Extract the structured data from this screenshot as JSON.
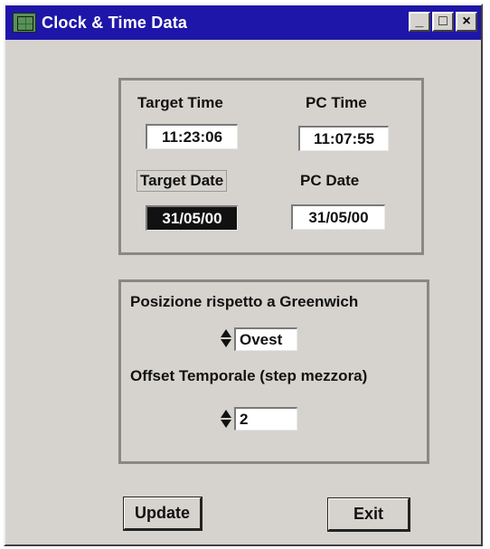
{
  "window": {
    "title": "Clock & Time Data",
    "controls": {
      "minimize": "_",
      "maximize": "□",
      "close": "×"
    }
  },
  "time_group": {
    "target_time_label": "Target Time",
    "target_time_value": "11:23:06",
    "pc_time_label": "PC Time",
    "pc_time_value": "11:07:55",
    "target_date_label": "Target Date",
    "target_date_value": "31/05/00",
    "pc_date_label": "PC Date",
    "pc_date_value": "31/05/00"
  },
  "greenwich_group": {
    "position_label": "Posizione rispetto a Greenwich",
    "position_value": "Ovest",
    "offset_label": "Offset Temporale (step mezzora)",
    "offset_value": "2"
  },
  "buttons": {
    "update": "Update",
    "exit": "Exit"
  },
  "colors": {
    "titlebar": "#1e16a8",
    "window_bg": "#d6d3ce"
  }
}
